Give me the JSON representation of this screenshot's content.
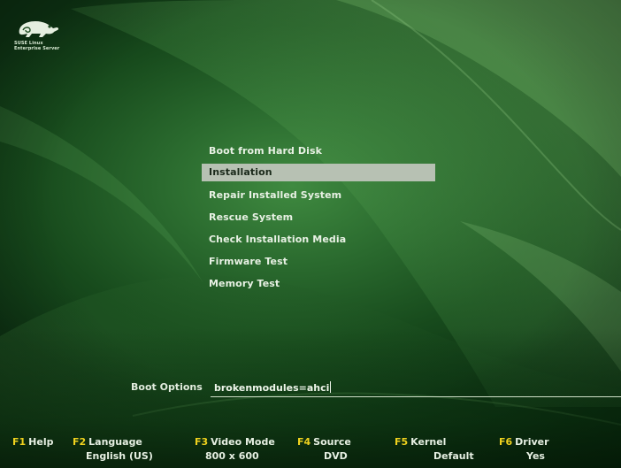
{
  "logo": {
    "icon": "chameleon-icon",
    "line1": "SUSE Linux",
    "line2": "Enterprise Server"
  },
  "menu": {
    "items": [
      {
        "label": "Boot from Hard Disk",
        "selected": false
      },
      {
        "label": "Installation",
        "selected": true
      },
      {
        "label": "Repair Installed System",
        "selected": false
      },
      {
        "label": "Rescue System",
        "selected": false
      },
      {
        "label": "Check Installation Media",
        "selected": false
      },
      {
        "label": "Firmware Test",
        "selected": false
      },
      {
        "label": "Memory Test",
        "selected": false
      }
    ]
  },
  "boot_options": {
    "label": "Boot Options",
    "value": "brokenmodules=ahci"
  },
  "function_keys": [
    {
      "key": "F1",
      "name": "Help",
      "value": ""
    },
    {
      "key": "F2",
      "name": "Language",
      "value": "English (US)"
    },
    {
      "key": "F3",
      "name": "Video Mode",
      "value": "800 x 600"
    },
    {
      "key": "F4",
      "name": "Source",
      "value": "DVD"
    },
    {
      "key": "F5",
      "name": "Kernel",
      "value": "Default"
    },
    {
      "key": "F6",
      "name": "Driver",
      "value": "Yes"
    }
  ],
  "colors": {
    "background": "#2a6a2e",
    "selection": "#b7c1b3",
    "fkey_key": "#f0d21e",
    "text": "#e8f1e4"
  }
}
